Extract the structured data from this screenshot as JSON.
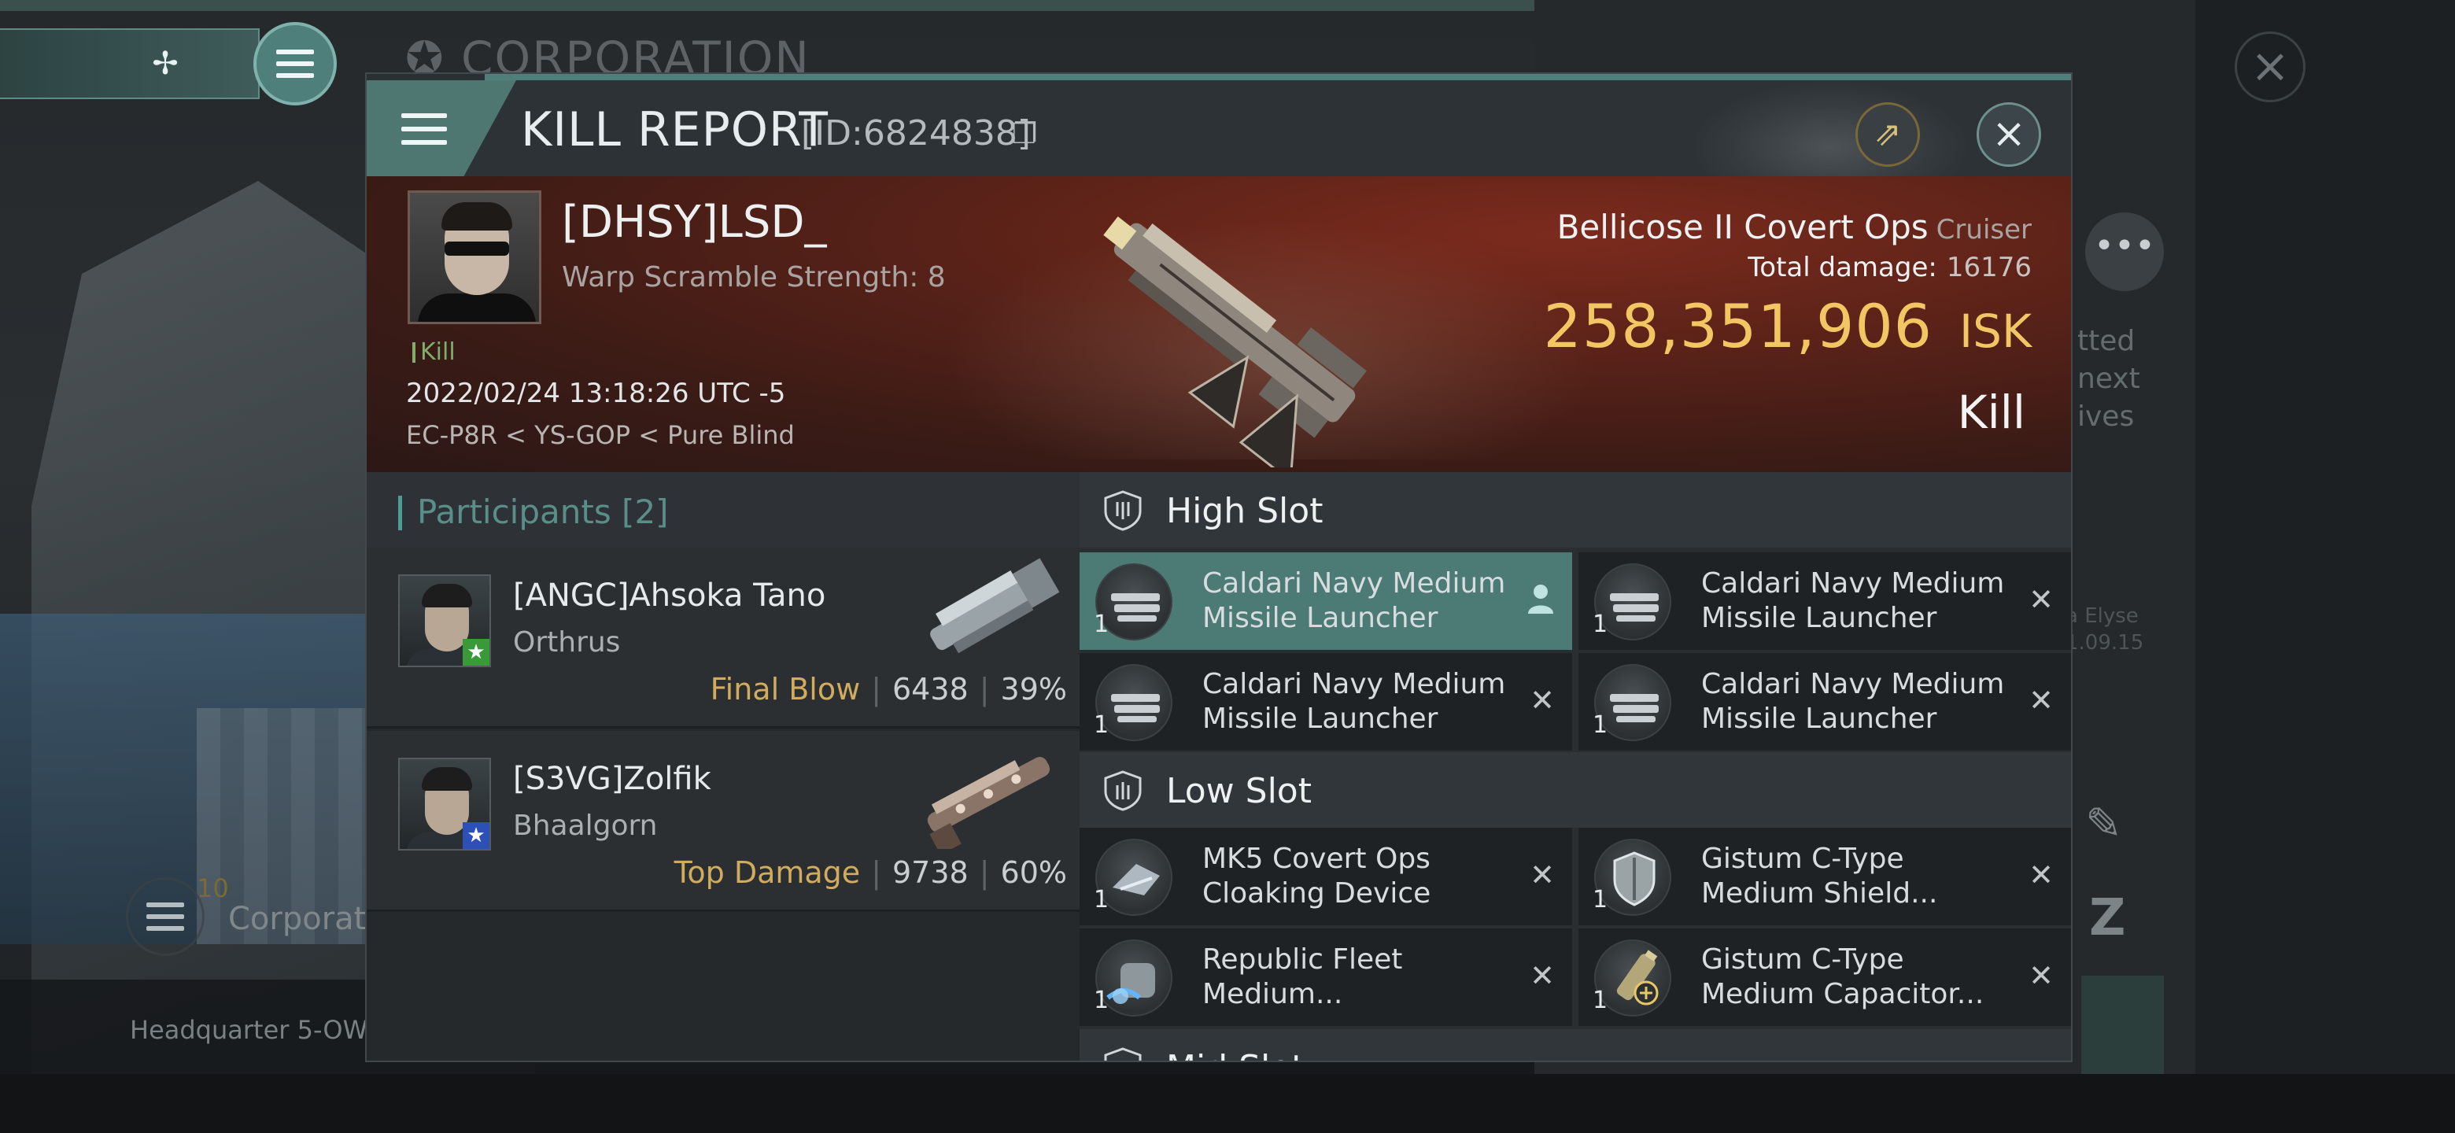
{
  "background": {
    "title": "CORPORATION",
    "side_text": "tted\nnext\nives",
    "side_name": "a Elyse\n1.09.15",
    "corp_count": "10",
    "corp_label": "Corporati",
    "headquarter": "Headquarter 5-OW"
  },
  "dialog": {
    "title": "KILL REPORT",
    "id": "[ID:6824838]",
    "victim": {
      "name": "[DHSY]LSD_",
      "warp_scramble": "Warp Scramble Strength: 8",
      "kill_tag": "Kill",
      "date": "2022/02/24 13:18:26 UTC -5",
      "location": "EC-P8R < YS-GOP < Pure Blind",
      "ship_name": "Bellicose II Covert Ops",
      "ship_class": "Cruiser",
      "total_damage_label": "Total damage:",
      "total_damage": "16176",
      "isk_value": "258,351,906",
      "isk_unit": "ISK",
      "report_type": "Kill"
    },
    "participants": {
      "title": "Participants [2]",
      "items": [
        {
          "name": "[ANGC]Ahsoka Tano",
          "ship": "Orthrus",
          "role": "Final Blow",
          "damage": "6438",
          "percent": "39%",
          "badge_color": "#3a9a3a"
        },
        {
          "name": "[S3VG]Zolfik",
          "ship": "Bhaalgorn",
          "role": "Top Damage",
          "damage": "9738",
          "percent": "60%",
          "badge_color": "#2d4fb8"
        }
      ]
    },
    "high_slot": {
      "label": "High Slot",
      "items": [
        {
          "name": "Caldari Navy Medium Missile Launcher",
          "qty": "1",
          "status": "pilot",
          "selected": true
        },
        {
          "name": "Caldari Navy Medium Missile Launcher",
          "qty": "1",
          "status": "destroyed"
        },
        {
          "name": "Caldari Navy Medium Missile Launcher",
          "qty": "1",
          "status": "destroyed"
        },
        {
          "name": "Caldari Navy Medium Missile Launcher",
          "qty": "1",
          "status": "destroyed"
        }
      ]
    },
    "low_slot": {
      "label": "Low Slot",
      "items": [
        {
          "name": "MK5 Covert Ops Cloaking Device",
          "qty": "1",
          "status": "destroyed"
        },
        {
          "name": "Gistum C-Type Medium Shield...",
          "qty": "1",
          "status": "destroyed"
        },
        {
          "name": "Republic Fleet Medium...",
          "qty": "1",
          "status": "destroyed"
        },
        {
          "name": "Gistum C-Type Medium Capacitor...",
          "qty": "1",
          "status": "destroyed"
        }
      ]
    },
    "mid_slot": {
      "label": "Mid Slot"
    }
  },
  "colors": {
    "accent_teal": "#4f7f7a",
    "isk_gold": "#f2c763",
    "banner_red": "#5a2218",
    "final_blow_gold": "#d2ac5e"
  },
  "icons": [
    "map-icon",
    "menu-icon",
    "copy-icon",
    "share-icon",
    "close-icon",
    "shield-slot-icon",
    "pilot-icon",
    "destroyed-x-icon",
    "star-badge-icon"
  ]
}
